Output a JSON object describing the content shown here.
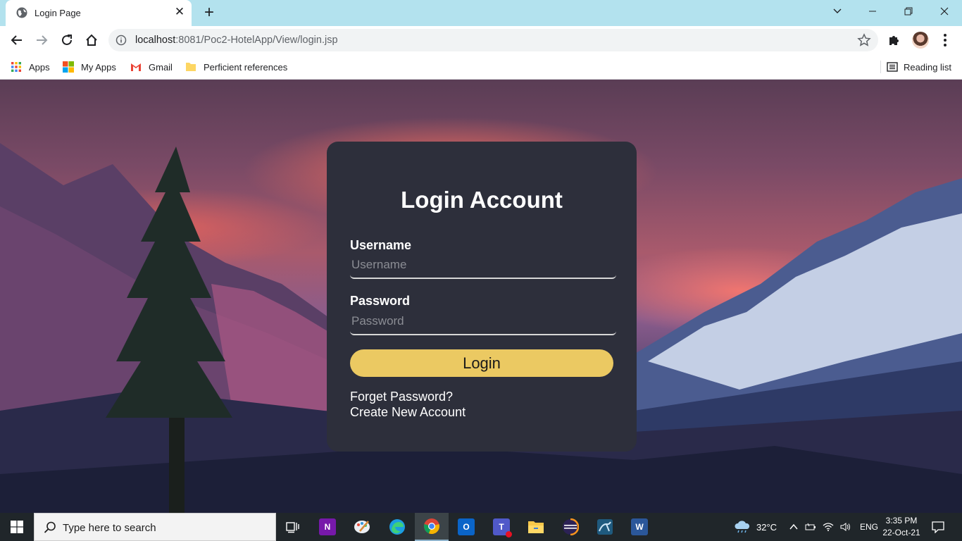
{
  "browser": {
    "tab": {
      "title": "Login Page",
      "icon": "globe-icon"
    },
    "address": {
      "host": "localhost",
      "port": ":8081",
      "path": "/Poc2-HotelApp/View/login.jsp"
    },
    "bookmarks": [
      {
        "label": "Apps",
        "icon": "apps-grid-icon"
      },
      {
        "label": "My Apps",
        "icon": "microsoft-logo-icon"
      },
      {
        "label": "Gmail",
        "icon": "gmail-icon"
      },
      {
        "label": "Perficient references",
        "icon": "folder-icon"
      }
    ],
    "reading_list": "Reading list"
  },
  "login": {
    "title": "Login Account",
    "username_label": "Username",
    "username_placeholder": "Username",
    "password_label": "Password",
    "password_placeholder": "Password",
    "login_button": "Login",
    "forgot_link": "Forget Password?",
    "create_link": "Create New Account"
  },
  "taskbar": {
    "search_placeholder": "Type here to search",
    "apps": [
      "task-view",
      "onenote",
      "paint",
      "edge",
      "chrome",
      "outlook",
      "teams",
      "file-explorer",
      "eclipse",
      "mysql-workbench",
      "word"
    ],
    "active_app": "chrome",
    "weather": "32°C",
    "language": "ENG",
    "time": "3:35 PM",
    "date": "22-Oct-21"
  }
}
